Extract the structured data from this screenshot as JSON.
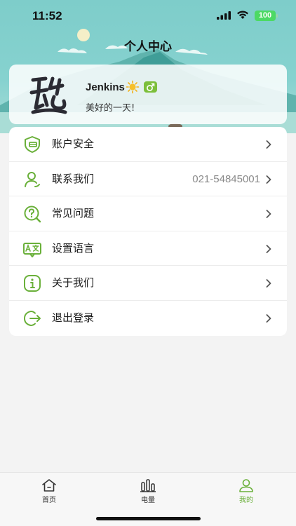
{
  "status_bar": {
    "time": "11:52",
    "battery": "100"
  },
  "header": {
    "title": "个人中心"
  },
  "profile": {
    "avatar_icon": "calligraphy-avatar",
    "username": "Jenkins",
    "status_emoji_icon": "sun-icon",
    "gender_icon": "male-icon",
    "motto": "美好的一天!"
  },
  "menu": {
    "items": [
      {
        "label": "账户安全",
        "icon": "shield-icon",
        "value": ""
      },
      {
        "label": "联系我们",
        "icon": "contact-user-icon",
        "value": "021-54845001"
      },
      {
        "label": "常见问题",
        "icon": "faq-search-icon",
        "value": ""
      },
      {
        "label": "设置语言",
        "icon": "translate-icon",
        "value": ""
      },
      {
        "label": "关于我们",
        "icon": "info-icon",
        "value": ""
      },
      {
        "label": "退出登录",
        "icon": "logout-icon",
        "value": ""
      }
    ]
  },
  "tabbar": {
    "tabs": [
      {
        "label": "首页",
        "icon": "home-icon",
        "active": false
      },
      {
        "label": "电量",
        "icon": "bar-chart-icon",
        "active": false
      },
      {
        "label": "我的",
        "icon": "user-icon",
        "active": true
      }
    ]
  },
  "colors": {
    "accent": "#6ab03a",
    "header_bg": "#7ecdca"
  }
}
